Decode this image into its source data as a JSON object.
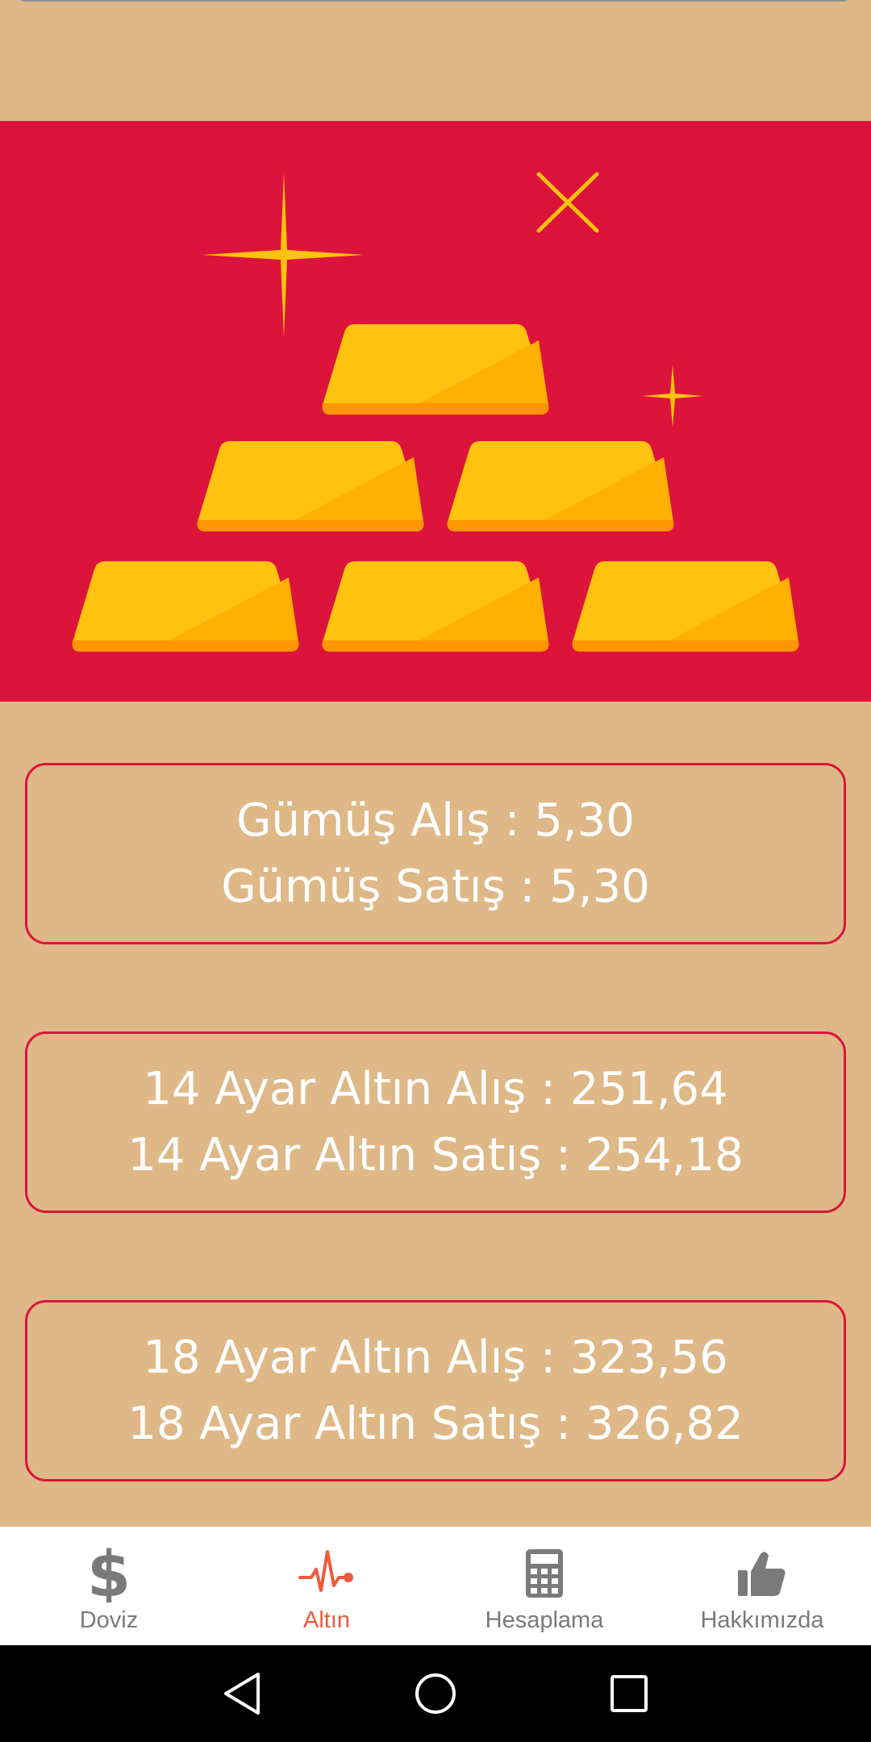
{
  "colors": {
    "background": "#DEB887",
    "banner": "#DC143C",
    "card_border": "#DC143C",
    "active_tab": "#EE5A3C",
    "inactive_tab": "#7A7A7A",
    "gold_light": "#FFC20E",
    "gold_dark": "#FFA500"
  },
  "banner": {
    "image": "gold-bars-illustration"
  },
  "prices": {
    "gumus": {
      "alis": "Gümüş Alış : 5,30",
      "satis": "Gümüş Satış : 5,30"
    },
    "ayar14": {
      "alis": "14 Ayar Altın Alış : 251,64",
      "satis": "14 Ayar Altın Satış : 254,18"
    },
    "ayar18": {
      "alis": "18 Ayar Altın Alış : 323,56",
      "satis": "18 Ayar Altın Satış : 326,82"
    }
  },
  "bottom_nav": {
    "active": "Altın",
    "items": [
      {
        "label": "Doviz",
        "icon": "dollar-icon"
      },
      {
        "label": "Altın",
        "icon": "pulse-icon"
      },
      {
        "label": "Hesaplama",
        "icon": "calculator-icon"
      },
      {
        "label": "Hakkımızda",
        "icon": "thumbs-up-icon"
      }
    ]
  },
  "system_nav": {
    "buttons": [
      "back-icon",
      "home-icon",
      "recents-icon"
    ]
  }
}
